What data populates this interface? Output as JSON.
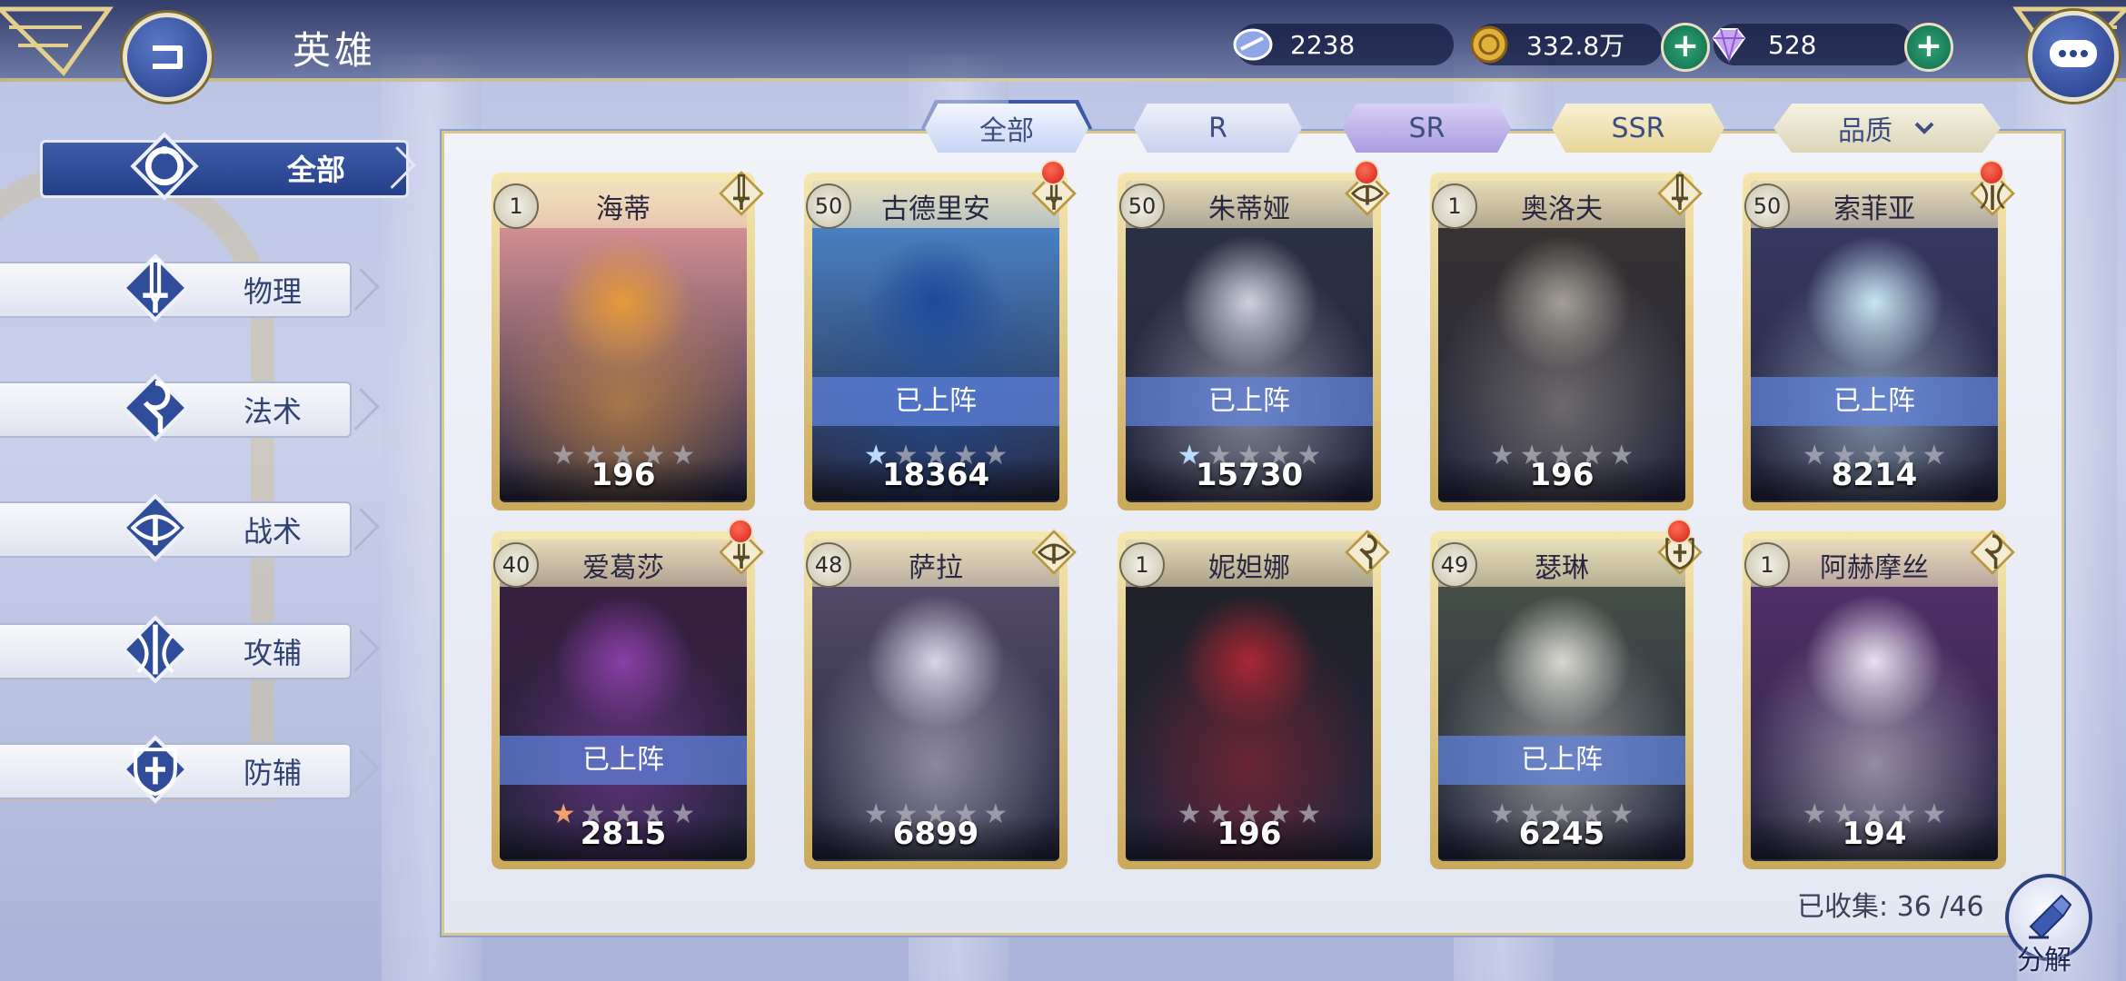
{
  "header": {
    "title": "英雄",
    "resources": [
      {
        "icon": "stamina-icon",
        "value": "2238"
      },
      {
        "icon": "gold-coin-icon",
        "value": "332.8万"
      },
      {
        "icon": "diamond-icon",
        "value": "528"
      }
    ]
  },
  "sidebar": {
    "items": [
      {
        "label": "全部",
        "icon": "all-ring-icon",
        "active": true
      },
      {
        "label": "物理",
        "icon": "sword-icon",
        "active": false
      },
      {
        "label": "法术",
        "icon": "magic-staff-icon",
        "active": false
      },
      {
        "label": "战术",
        "icon": "eye-icon",
        "active": false
      },
      {
        "label": "攻辅",
        "icon": "support-attack-icon",
        "active": false
      },
      {
        "label": "防辅",
        "icon": "shield-cross-icon",
        "active": false
      }
    ]
  },
  "tabs": [
    {
      "label": "全部",
      "active": true
    },
    {
      "label": "R",
      "active": false
    },
    {
      "label": "SR",
      "active": false
    },
    {
      "label": "SSR",
      "active": false
    },
    {
      "label": "品质",
      "active": false,
      "dropdown": true
    }
  ],
  "deployed_label": "已上阵",
  "heroes": [
    {
      "name": "海蒂",
      "level": "1",
      "power": "196",
      "deployed": false,
      "stars_filled": 0,
      "star_color": "",
      "role": "sword-icon",
      "notify": false,
      "colors": [
        "#f0a0a0",
        "#e39a3a"
      ]
    },
    {
      "name": "古德里安",
      "level": "50",
      "power": "18364",
      "deployed": true,
      "stars_filled": 1,
      "star_color": "blue",
      "role": "sword-icon",
      "notify": true,
      "colors": [
        "#4f8fd8",
        "#1c4a9a"
      ]
    },
    {
      "name": "朱蒂娅",
      "level": "50",
      "power": "15730",
      "deployed": true,
      "stars_filled": 1,
      "star_color": "blue",
      "role": "eye-icon",
      "notify": true,
      "colors": [
        "#2c3246",
        "#cfd2dc"
      ]
    },
    {
      "name": "奥洛夫",
      "level": "1",
      "power": "196",
      "deployed": false,
      "stars_filled": 0,
      "star_color": "",
      "role": "sword-icon",
      "notify": false,
      "colors": [
        "#3a3530",
        "#a39f96"
      ]
    },
    {
      "name": "索菲亚",
      "level": "50",
      "power": "8214",
      "deployed": true,
      "stars_filled": 0,
      "star_color": "",
      "role": "support-attack-icon",
      "notify": true,
      "colors": [
        "#3a3a66",
        "#c8e6f4"
      ]
    },
    {
      "name": "爱葛莎",
      "level": "40",
      "power": "2815",
      "deployed": true,
      "stars_filled": 1,
      "star_color": "orange",
      "role": "sword-icon",
      "notify": true,
      "colors": [
        "#3b1e40",
        "#8a3fa8"
      ]
    },
    {
      "name": "萨拉",
      "level": "48",
      "power": "6899",
      "deployed": false,
      "stars_filled": 0,
      "star_color": "",
      "role": "eye-icon",
      "notify": false,
      "colors": [
        "#5a5070",
        "#d8d4e8"
      ]
    },
    {
      "name": "妮妲娜",
      "level": "1",
      "power": "196",
      "deployed": false,
      "stars_filled": 0,
      "star_color": "",
      "role": "magic-staff-icon",
      "notify": false,
      "colors": [
        "#202024",
        "#a82632"
      ]
    },
    {
      "name": "瑟琳",
      "level": "49",
      "power": "6245",
      "deployed": true,
      "stars_filled": 0,
      "star_color": "",
      "role": "shield-cross-icon",
      "notify": true,
      "colors": [
        "#4a5648",
        "#d8d8d0"
      ]
    },
    {
      "name": "阿赫摩丝",
      "level": "1",
      "power": "194",
      "deployed": false,
      "stars_filled": 0,
      "star_color": "",
      "role": "magic-staff-icon",
      "notify": false,
      "colors": [
        "#5a3070",
        "#e8e0f0"
      ]
    }
  ],
  "collection": {
    "text": "已收集: 36 /46"
  },
  "decompose": {
    "label": "分解",
    "icon": "decompose-icon"
  }
}
